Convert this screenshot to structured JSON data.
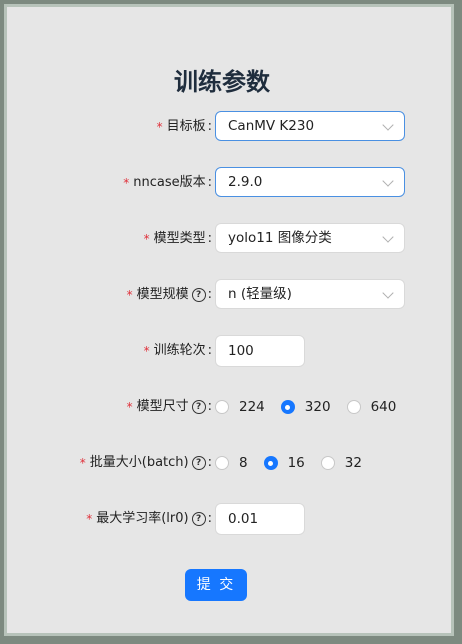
{
  "title": "训练参数",
  "fields": {
    "board": {
      "label": "目标板",
      "value": "CanMV K230"
    },
    "nncase": {
      "label": "nncase版本",
      "value": "2.9.0"
    },
    "model_type": {
      "label": "模型类型",
      "value": "yolo11 图像分类"
    },
    "model_scale": {
      "label": "模型规模",
      "value": "n (轻量级)"
    },
    "epochs": {
      "label": "训练轮次",
      "value": "100"
    },
    "model_size": {
      "label": "模型尺寸",
      "options": [
        "224",
        "320",
        "640"
      ],
      "selected": "320"
    },
    "batch": {
      "label": "批量大小(batch)",
      "options": [
        "8",
        "16",
        "32"
      ],
      "selected": "16"
    },
    "lr": {
      "label": "最大学习率(lr0)",
      "value": "0.01"
    }
  },
  "submit_label": "提 交",
  "colors": {
    "primary": "#1677ff",
    "required": "#e0303a"
  }
}
